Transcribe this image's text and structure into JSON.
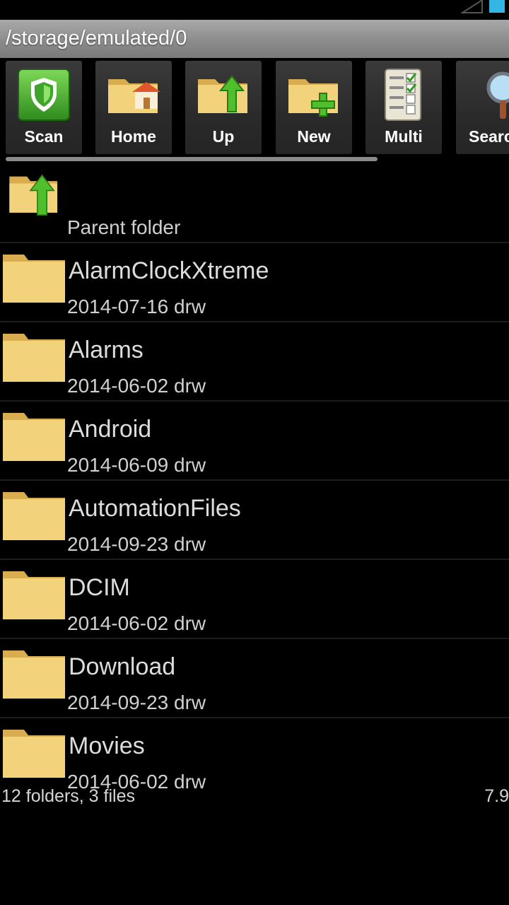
{
  "path": "/storage/emulated/0",
  "toolbar": {
    "buttons": [
      {
        "label": "Scan",
        "icon": "shield-scan-icon"
      },
      {
        "label": "Home",
        "icon": "home-folder-icon"
      },
      {
        "label": "Up",
        "icon": "up-folder-icon"
      },
      {
        "label": "New",
        "icon": "new-folder-icon"
      },
      {
        "label": "Multi",
        "icon": "multi-select-icon"
      },
      {
        "label": "Search",
        "icon": "search-icon"
      }
    ]
  },
  "list": {
    "parent": {
      "label": "Parent folder",
      "icon": "parent-folder-icon"
    },
    "items": [
      {
        "name": "AlarmClockXtreme",
        "meta": "2014-07-16 drw"
      },
      {
        "name": "Alarms",
        "meta": "2014-06-02 drw"
      },
      {
        "name": "Android",
        "meta": "2014-06-09 drw"
      },
      {
        "name": "AutomationFiles",
        "meta": "2014-09-23 drw"
      },
      {
        "name": "DCIM",
        "meta": "2014-06-02 drw"
      },
      {
        "name": "Download",
        "meta": "2014-09-23 drw"
      },
      {
        "name": "Movies",
        "meta": "2014-06-02 drw"
      }
    ]
  },
  "footer": {
    "summary": "12 folders, 3 files",
    "size": "7.9"
  },
  "colors": {
    "folder": "#f3d27c",
    "accent_green": "#4fbf2b",
    "battery": "#33b5e5"
  }
}
